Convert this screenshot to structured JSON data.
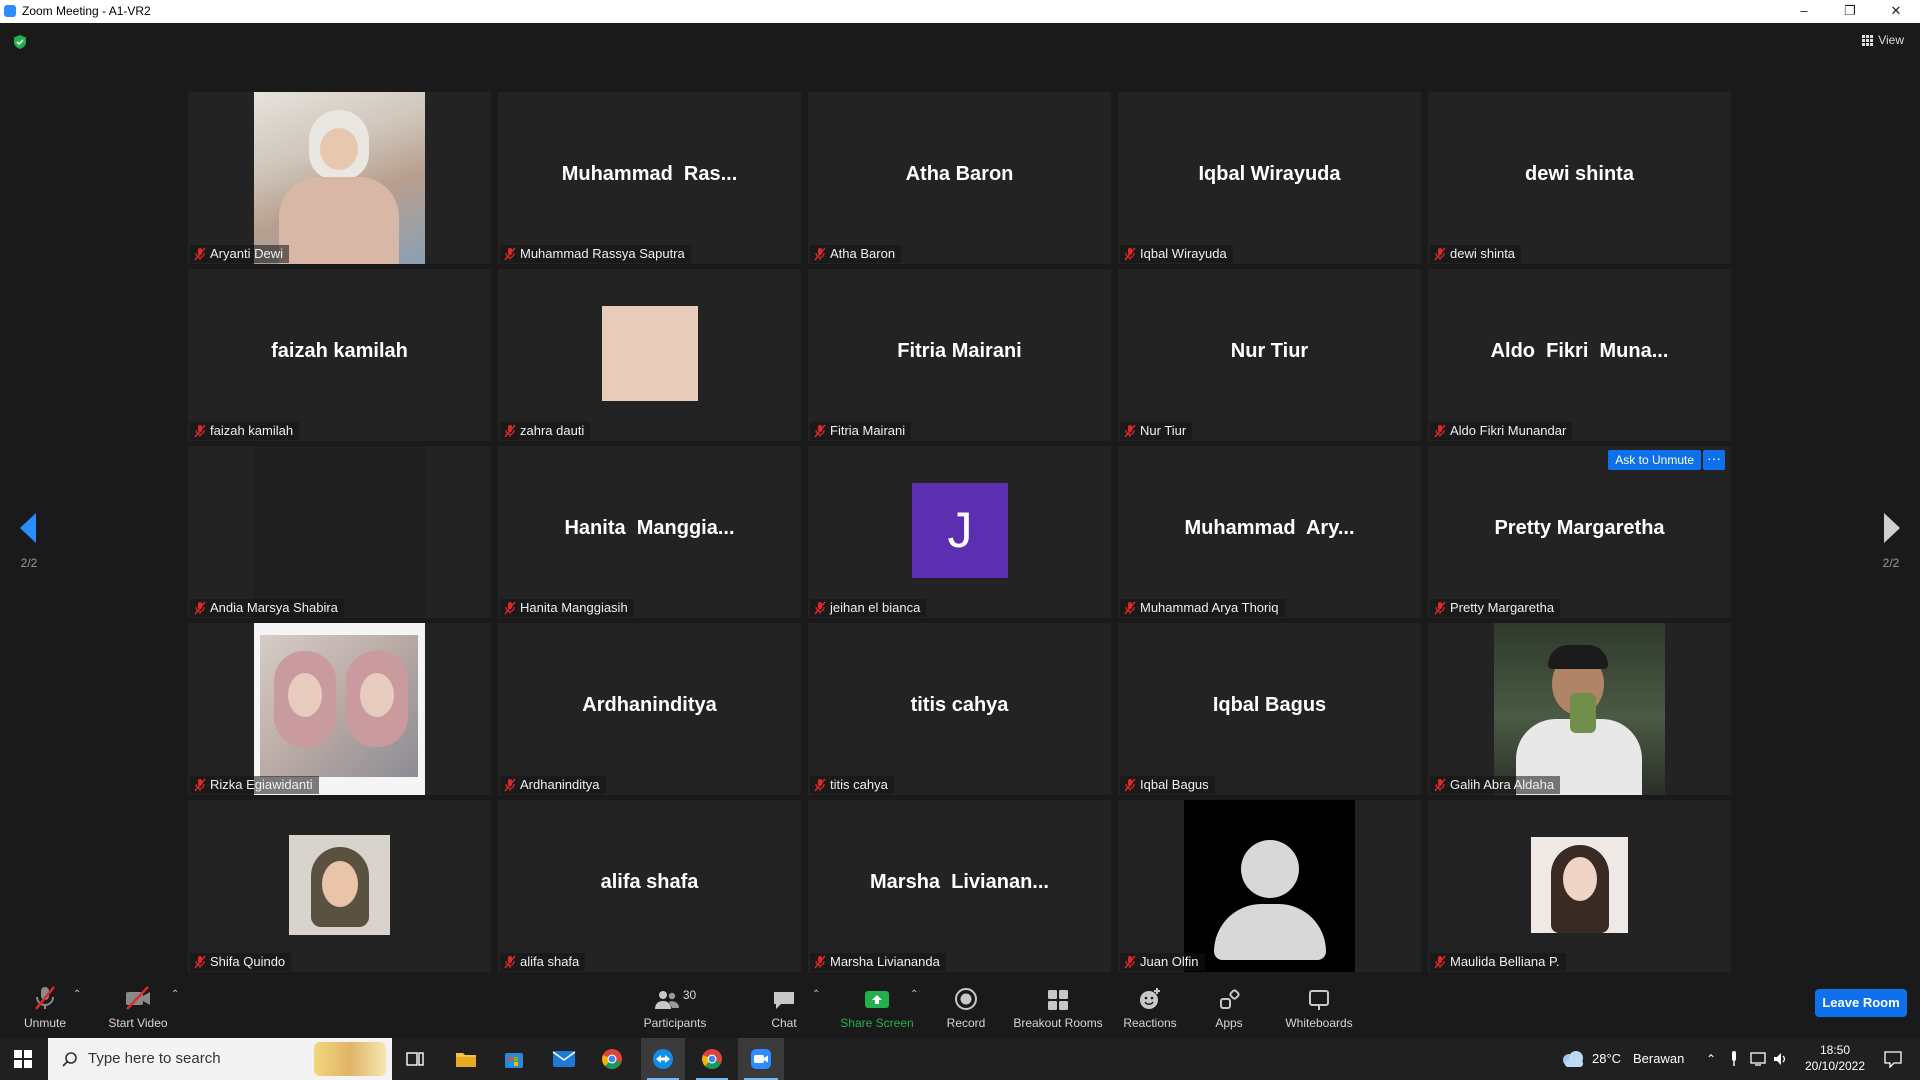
{
  "window": {
    "title": "Zoom Meeting - A1-VR2"
  },
  "view_label": "View",
  "pager": {
    "left": "2/2",
    "right": "2/2"
  },
  "tiles": [
    {
      "label": "Aryanti Dewi",
      "display": "",
      "photo": "photo-1"
    },
    {
      "label": "Muhammad Rassya Saputra",
      "display": "Muhammad  Ras..."
    },
    {
      "label": "Atha Baron",
      "display": "Atha Baron"
    },
    {
      "label": "Iqbal Wirayuda",
      "display": "Iqbal Wirayuda"
    },
    {
      "label": "dewi shinta",
      "display": "dewi shinta"
    },
    {
      "label": "faizah kamilah",
      "display": "faizah kamilah"
    },
    {
      "label": "zahra dauti",
      "display": "",
      "photo": "beige"
    },
    {
      "label": "Fitria Mairani",
      "display": "Fitria Mairani"
    },
    {
      "label": "Nur Tiur",
      "display": "Nur Tiur"
    },
    {
      "label": "Aldo Fikri Munandar",
      "display": "Aldo  Fikri  Muna..."
    },
    {
      "label": "Andia Marsya Shabira",
      "display": "",
      "photo": "dark"
    },
    {
      "label": "Hanita Manggiasih",
      "display": "Hanita  Manggia..."
    },
    {
      "label": "jeihan el bianca",
      "display": "",
      "photo": "avatar-j",
      "avatar_letter": "J"
    },
    {
      "label": "Muhammad Arya Thoriq",
      "display": "Muhammad  Ary..."
    },
    {
      "label": "Pretty Margaretha",
      "display": "Pretty Margaretha",
      "ask_to_unmute": "Ask to Unmute",
      "more": "···"
    },
    {
      "label": "Rizka Egiawidanti",
      "display": "",
      "photo": "photo-2"
    },
    {
      "label": "Ardhaninditya",
      "display": "Ardhaninditya"
    },
    {
      "label": "titis cahya",
      "display": "titis cahya"
    },
    {
      "label": "Iqbal Bagus",
      "display": "Iqbal Bagus"
    },
    {
      "label": "Galih Abra Aldaha",
      "display": "",
      "photo": "photo-3"
    },
    {
      "label": "Shifa Quindo",
      "display": "",
      "photo": "photo-4"
    },
    {
      "label": "alifa shafa",
      "display": "alifa shafa"
    },
    {
      "label": "Marsha Liviananda",
      "display": "Marsha  Livianan..."
    },
    {
      "label": "Juan Olfin",
      "display": "",
      "photo": "default-avatar"
    },
    {
      "label": "Maulida Belliana P.",
      "display": "",
      "photo": "photo-5"
    }
  ],
  "toolbar": {
    "unmute": "Unmute",
    "start_video": "Start Video",
    "participants": "Participants",
    "participants_count": "30",
    "chat": "Chat",
    "share_screen": "Share Screen",
    "record": "Record",
    "breakout_rooms": "Breakout Rooms",
    "reactions": "Reactions",
    "apps": "Apps",
    "whiteboards": "Whiteboards",
    "leave_room": "Leave Room"
  },
  "taskbar": {
    "search_placeholder": "Type here to search",
    "temperature": "28°C",
    "weather": "Berawan",
    "time": "18:50",
    "date": "20/10/2022"
  },
  "colors": {
    "accent": "#0e71eb",
    "share_green": "#23b14d",
    "mute_red": "#e02828",
    "avatar_j": "#5b2fb0"
  }
}
